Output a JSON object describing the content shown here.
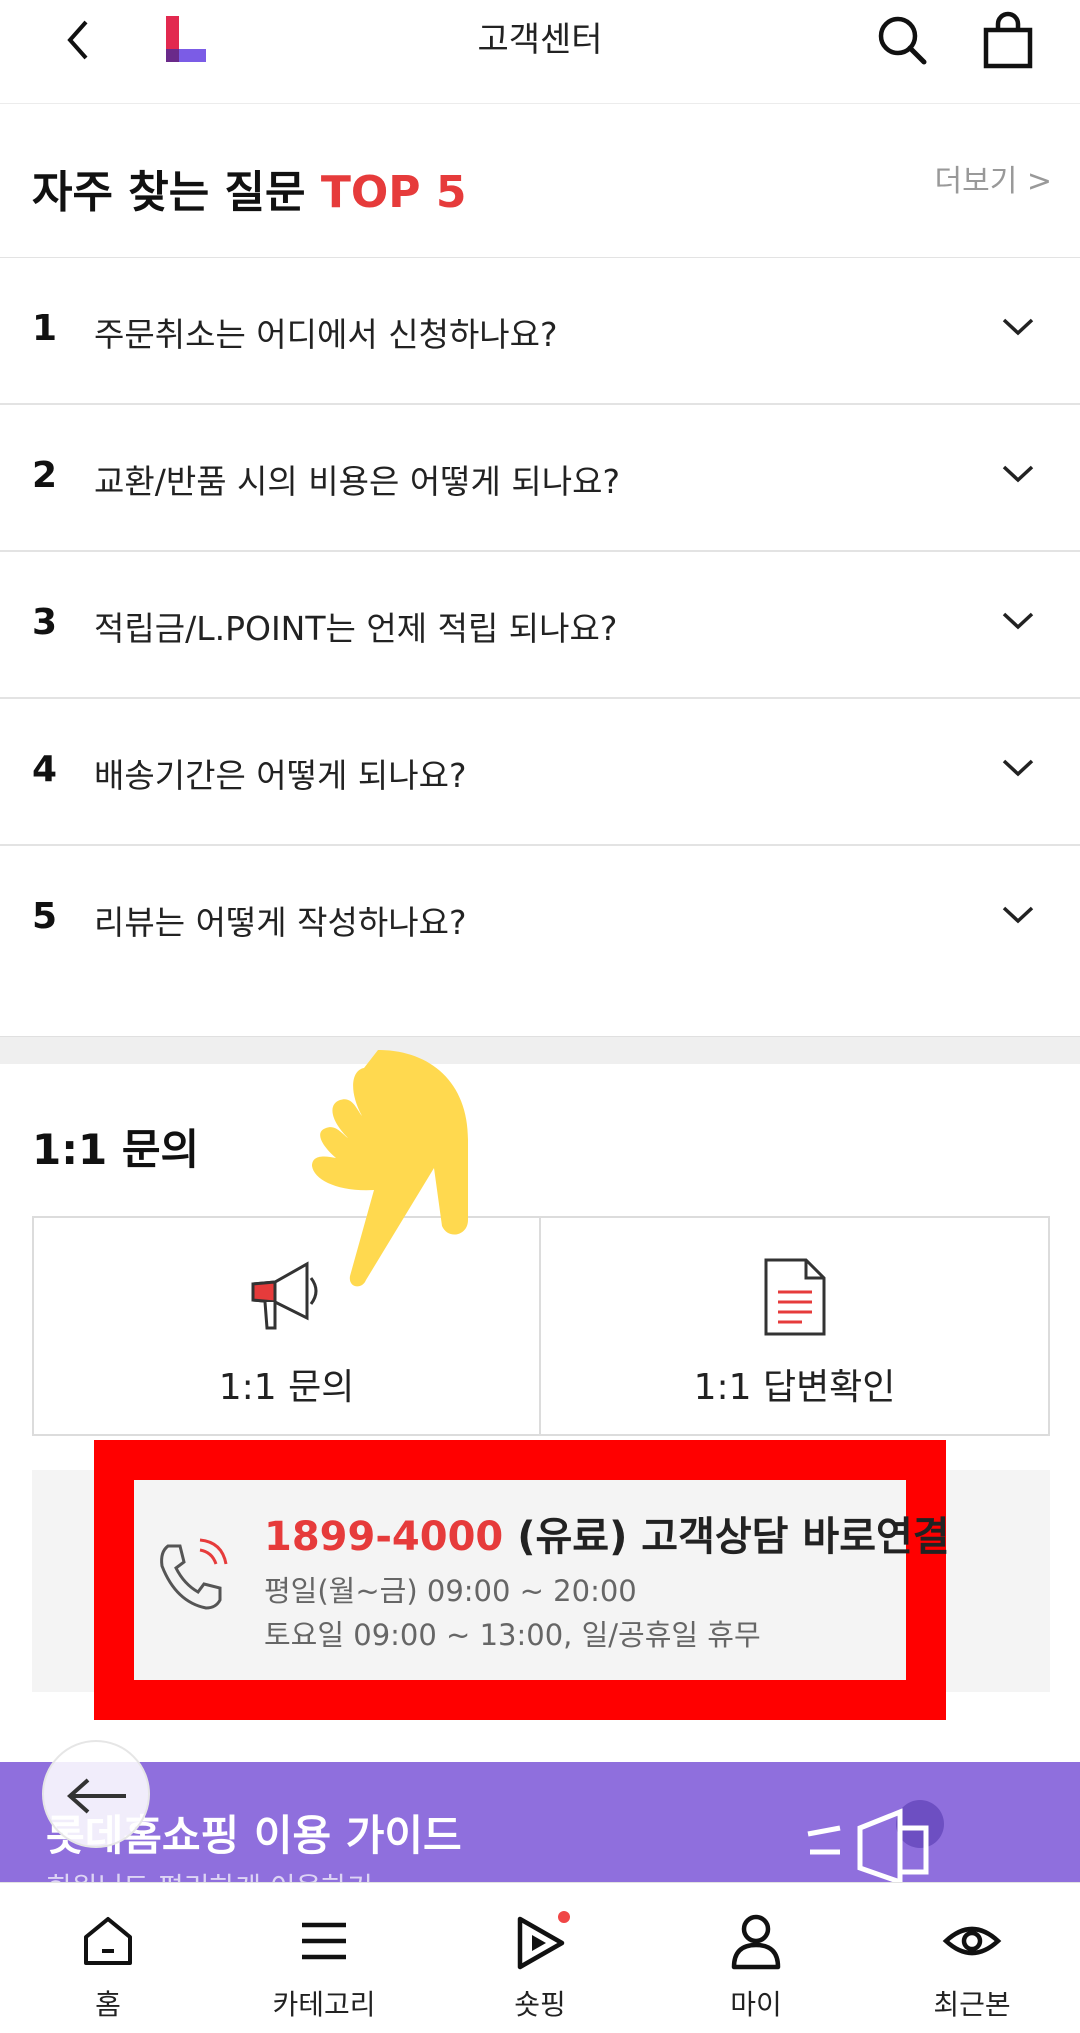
{
  "header": {
    "title": "고객센터",
    "brand_color": "#e63b3b",
    "logo_colors": [
      "#e2294f",
      "#7b5ce6"
    ]
  },
  "faq": {
    "title_main": "자주 찾는 질문",
    "title_accent": "TOP 5",
    "more_label": "더보기 >",
    "items": [
      {
        "num": "1",
        "question": "주문취소는 어디에서 신청하나요?"
      },
      {
        "num": "2",
        "question": "교환/반품 시의 비용은 어떻게 되나요?"
      },
      {
        "num": "3",
        "question": "적립금/L.POINT는 언제 적립 되나요?"
      },
      {
        "num": "4",
        "question": "배송기간은 어떻게 되나요?"
      },
      {
        "num": "5",
        "question": "리뷰는 어떻게 작성하나요?"
      }
    ]
  },
  "inquiry": {
    "section_title": "1:1 문의",
    "left_label": "1:1 문의",
    "right_label": "1:1 답변확인"
  },
  "call": {
    "phone": "1899-4000",
    "title_rest": " (유료) 고객상담 바로연결",
    "hours_weekday": "평일(월~금) 09:00 ~ 20:00",
    "hours_weekend": "토요일 09:00 ~ 13:00, 일/공휴일 휴무",
    "highlight_color": "#ff0000"
  },
  "guide": {
    "title": "롯데홈쇼핑 이용 가이드",
    "subtitle": "회원님도 편리하게 이용하기",
    "bg_color": "#8f6fdd"
  },
  "bottom_nav": {
    "items": [
      {
        "label": "홈",
        "icon": "home-icon"
      },
      {
        "label": "카테고리",
        "icon": "menu-icon"
      },
      {
        "label": "숏핑",
        "icon": "play-icon"
      },
      {
        "label": "마이",
        "icon": "person-icon"
      },
      {
        "label": "최근본",
        "icon": "eye-icon"
      }
    ]
  }
}
